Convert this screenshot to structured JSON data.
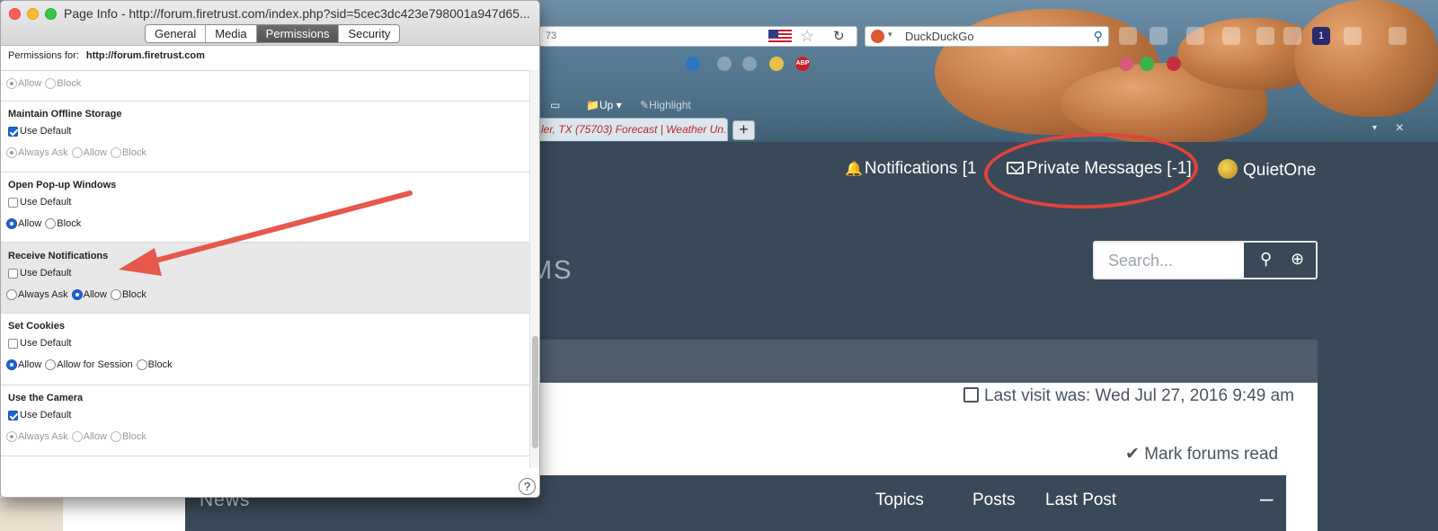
{
  "window": {
    "title": "Page Info - http://forum.firetrust.com/index.php?sid=5cec3dc423e798001a947d65...",
    "tabs": [
      {
        "label": "General",
        "active": false
      },
      {
        "label": "Media",
        "active": false
      },
      {
        "label": "Permissions",
        "active": true
      },
      {
        "label": "Security",
        "active": false
      }
    ],
    "permissions_for_label": "Permissions for:",
    "permissions_for_url": "http://forum.firetrust.com",
    "help_label": "?"
  },
  "permissions": {
    "top_partial": {
      "allow": "Allow",
      "block": "Block"
    },
    "offline_storage": {
      "title": "Maintain Offline Storage",
      "use_default": "Use Default",
      "always_ask": "Always Ask",
      "allow": "Allow",
      "block": "Block"
    },
    "popups": {
      "title": "Open Pop-up Windows",
      "use_default": "Use Default",
      "allow": "Allow",
      "block": "Block"
    },
    "notifications": {
      "title": "Receive Notifications",
      "use_default": "Use Default",
      "always_ask": "Always Ask",
      "allow": "Allow",
      "block": "Block"
    },
    "cookies": {
      "title": "Set Cookies",
      "use_default": "Use Default",
      "allow": "Allow",
      "allow_session": "Allow for Session",
      "block": "Block"
    },
    "camera": {
      "title": "Use the Camera",
      "use_default": "Use Default",
      "always_ask": "Always Ask",
      "allow": "Allow",
      "block": "Block"
    }
  },
  "browser": {
    "url_fragment": "73",
    "search_engine": "DuckDuckGo",
    "bookmark_up": "Up",
    "bookmark_highlight": "Highlight",
    "active_tab": "ler, TX (75703) Forecast | Weather Un...",
    "new_tab": "+",
    "close": "×",
    "abp": "ABP",
    "badge": "1"
  },
  "forum": {
    "notifications": "Notifications [1",
    "private_messages": "Private Messages [-1]",
    "username": "QuietOne",
    "title_fragment": "MS",
    "search_placeholder": "Search...",
    "last_visit": "Last visit was: Wed Jul 27, 2016 9:49 am",
    "mark_read": "Mark forums read",
    "category": "News",
    "columns": [
      "Topics",
      "Posts",
      "Last Post"
    ],
    "collapse": "–"
  },
  "colors": {
    "forum_dark": "#394958",
    "annotation_red": "#e0433a",
    "checkbox_blue": "#1c63d6"
  }
}
